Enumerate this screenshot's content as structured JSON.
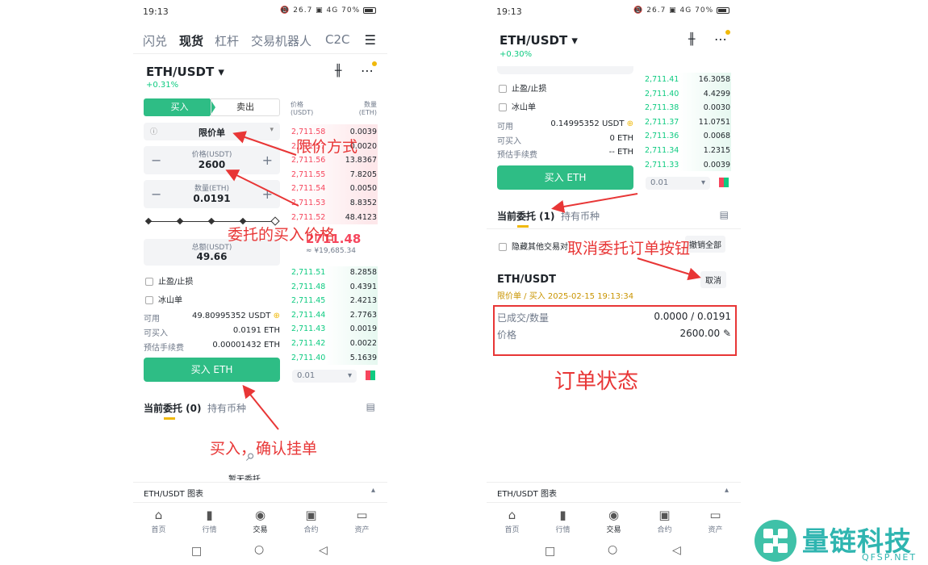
{
  "status": {
    "time": "19:13",
    "icons": "📵 26.7 ▣ 4G 70%"
  },
  "p1": {
    "tabs": [
      "闪兑",
      "现货",
      "杠杆",
      "交易机器人",
      "C2C"
    ],
    "menu_icon": "menu-icon",
    "pair": "ETH/USDT ▾",
    "change": "+0.31%",
    "buy_tab": "买入",
    "sell_tab": "卖出",
    "order_type": "限价单",
    "price_label": "价格(USDT)",
    "price_value": "2600",
    "qty_label": "数量(ETH)",
    "qty_value": "0.0191",
    "total_label": "总额(USDT)",
    "total_value": "49.66",
    "tp_sl": "止盈/止损",
    "iceberg": "冰山单",
    "avail_label": "可用",
    "avail_value": "49.80995352 USDT",
    "canbuy_label": "可买入",
    "canbuy_value": "0.0191 ETH",
    "fee_label": "预估手续费",
    "fee_value": "0.00001432 ETH",
    "buy_button": "买入 ETH",
    "ob_head_price": "价格\n(USDT)",
    "ob_head_qty": "数量\n(ETH)",
    "asks": [
      [
        "2,711.58",
        "0.0039"
      ],
      [
        "2,711.57",
        "0.0020"
      ],
      [
        "2,711.56",
        "13.8367"
      ],
      [
        "2,711.55",
        "7.8205"
      ],
      [
        "2,711.54",
        "0.0050"
      ],
      [
        "2,711.53",
        "8.8352"
      ],
      [
        "2,711.52",
        "48.4123"
      ]
    ],
    "mid_price": "2711.48",
    "mid_cny": "≈ ¥19,685.34",
    "bids": [
      [
        "2,711.51",
        "8.2858"
      ],
      [
        "2,711.48",
        "0.4391"
      ],
      [
        "2,711.45",
        "2.4213"
      ],
      [
        "2,711.44",
        "2.7763"
      ],
      [
        "2,711.43",
        "0.0019"
      ],
      [
        "2,711.42",
        "0.0022"
      ],
      [
        "2,711.40",
        "5.1639"
      ]
    ],
    "depth": "0.01",
    "orders_tab": "当前委托 (0)",
    "holdings_tab": "持有币种",
    "empty_text": "暂无委托",
    "chart_label": "ETH/USDT 图表"
  },
  "p2": {
    "pair": "ETH/USDT ▾",
    "change": "+0.30%",
    "tp_sl": "止盈/止损",
    "iceberg": "冰山单",
    "avail_label": "可用",
    "avail_value": "0.14995352 USDT",
    "canbuy_label": "可买入",
    "canbuy_value": "0 ETH",
    "fee_label": "预估手续费",
    "fee_value": "-- ETH",
    "buy_button": "买入 ETH",
    "bids": [
      [
        "2,711.41",
        "16.3058"
      ],
      [
        "2,711.40",
        "4.4299"
      ],
      [
        "2,711.38",
        "0.0030"
      ],
      [
        "2,711.37",
        "11.0751"
      ],
      [
        "2,711.36",
        "0.0068"
      ],
      [
        "2,711.34",
        "1.2315"
      ],
      [
        "2,711.33",
        "0.0039"
      ]
    ],
    "depth": "0.01",
    "orders_tab": "当前委托 (1)",
    "holdings_tab": "持有币种",
    "hide_other": "隐藏其他交易对",
    "cancel_all": "撤销全部",
    "order_pair": "ETH/USDT",
    "order_meta": "限价单 / 买入  2025-02-15 19:13:34",
    "cancel_btn": "取消",
    "filled_label": "已成交/数量",
    "filled_value": "0.0000 / 0.0191",
    "price_label": "价格",
    "price_value": "2600.00",
    "chart_label": "ETH/USDT 图表"
  },
  "bottom_nav": [
    "首页",
    "行情",
    "交易",
    "合约",
    "资产"
  ],
  "annotations": {
    "limit": "限价方式",
    "entrust_price": "委托的买入价格",
    "confirm": "买入，确认挂单",
    "cancel": "取消委托订单按钮",
    "status": "订单状态"
  },
  "logo": {
    "name": "量链科技",
    "site": "QFSP.NET"
  },
  "colors": {
    "green": "#2ebd85",
    "red": "#f6465d",
    "annot": "#e83636"
  }
}
